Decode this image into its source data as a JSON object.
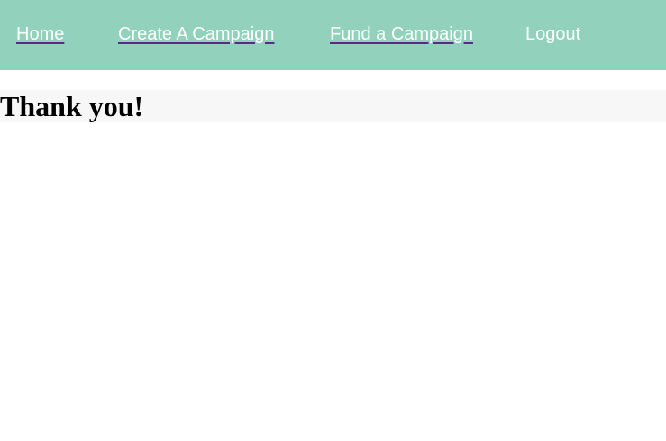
{
  "nav": {
    "home": "Home",
    "create_campaign": "Create A Campaign",
    "fund_campaign": "Fund a Campaign",
    "logout": "Logout"
  },
  "main": {
    "title": "Thank you!"
  },
  "colors": {
    "navbar_background": "#92d1bb",
    "nav_text": "#ffffff",
    "link_underline": "#5b2a86",
    "title_band_background": "#f7f7f7"
  }
}
